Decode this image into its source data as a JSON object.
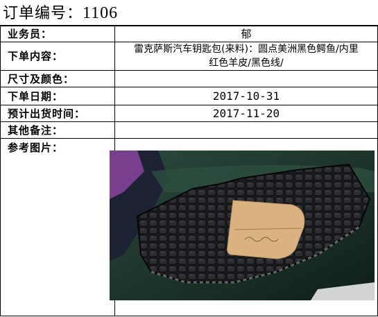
{
  "header": {
    "title_label": "订单编号：",
    "order_number": "1106"
  },
  "fields": {
    "salesperson_label": "业务员：",
    "salesperson_value": "郁",
    "order_content_label": "下单内容：",
    "order_content_line1": "雷克萨斯汽车钥匙包(来料)：圆点美洲黑色鳄鱼/内里",
    "order_content_line2": "红色羊皮/黑色线/",
    "size_color_label": "尺寸及颜色：",
    "size_color_value": "",
    "order_date_label": "下单日期：",
    "order_date_value": "2017-10-31",
    "ship_date_label": "预计出货时间：",
    "ship_date_value": "2017-11-20",
    "remarks_label": "其他备注：",
    "remarks_value": "",
    "reference_label": "参考图片："
  },
  "colors": {
    "border": "#000000",
    "leather": "#1b1c1f",
    "background_green": "#1f3a30",
    "template_card": "#d9b27f"
  }
}
